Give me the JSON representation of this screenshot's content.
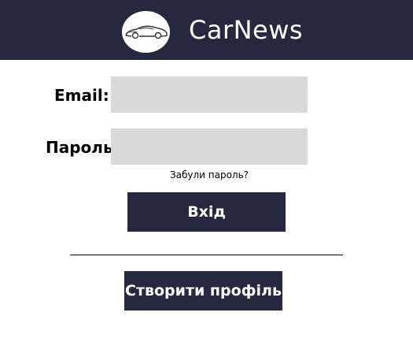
{
  "header": {
    "brand": "CarNews",
    "logo_icon": "car-icon",
    "background": "#262840"
  },
  "login_form": {
    "email_label": "Email:",
    "email_value": "",
    "password_label": "Пароль:",
    "password_value": "",
    "forgot_password": "Забули пароль?",
    "login_button": "Вхід",
    "create_profile_button": "Створити профіль",
    "field_color": "#d9d9d9",
    "button_color": "#262840"
  }
}
